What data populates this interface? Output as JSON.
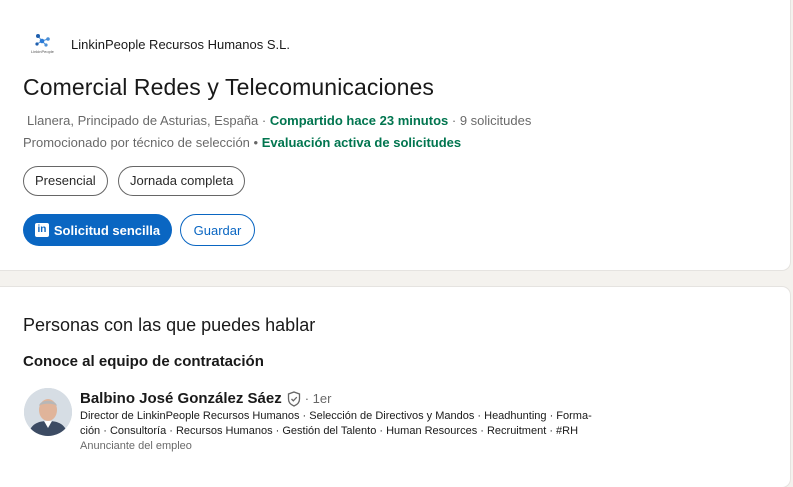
{
  "company": {
    "name": "LinkinPeople Recursos Humanos S.L.",
    "logo_text": "LinkinPeople"
  },
  "job": {
    "title": "Comercial Redes y Telecomunicaciones",
    "location": "Llanera, Principado de Asturias, España",
    "sep1": " · ",
    "posted": "Compartido hace 23 minutos",
    "sep2": " · ",
    "applicants": "9 solicitudes",
    "promoted": "Promocionado por técnico de selección",
    "sep3": " • ",
    "review_status": "Evaluación activa de solicitudes",
    "tags": [
      "Presencial",
      "Jornada completa"
    ],
    "apply_label": "Solicitud sencilla",
    "save_label": "Guardar"
  },
  "people": {
    "section_title": "Personas con las que puedes hablar",
    "team_title": "Conoce al equipo de contratación",
    "person": {
      "name": "Balbino José González Sáez",
      "degree": "· 1er",
      "headline_line1": "Director de LinkinPeople Recursos Humanos · Selección de Directivos y Mandos · Headhunting · Forma-",
      "headline_line2": "ción · Consultoría · Recursos Humanos · Gestión del Talento · Human Resources · Recruitment · #RH",
      "role": "Anunciante del empleo"
    }
  },
  "colors": {
    "brand_blue": "#0a66c2",
    "green": "#01754f",
    "background": "#f4f2ee"
  },
  "icons": [
    "company-logo-icon",
    "linkedin-icon",
    "verified-shield-icon"
  ]
}
